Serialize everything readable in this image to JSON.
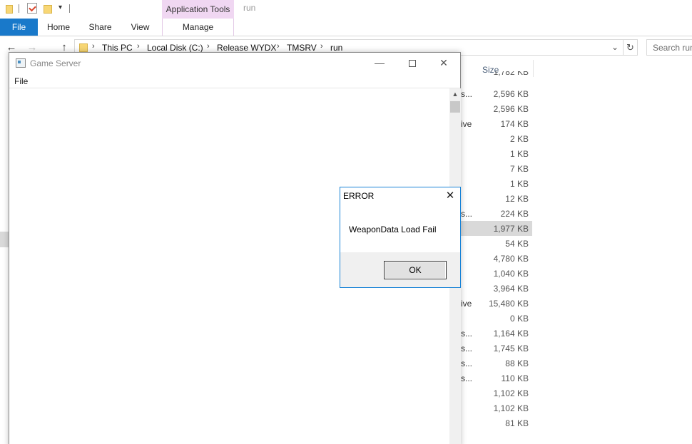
{
  "explorer": {
    "window_title": "run",
    "contextual_tab_group": "Application Tools",
    "ribbon_tabs": [
      "File",
      "Home",
      "Share",
      "View",
      "Manage"
    ],
    "breadcrumbs": [
      "This PC",
      "Local Disk (C:)",
      "Release WYDX",
      "TMSRV",
      "run"
    ],
    "search_placeholder": "Search run",
    "size_column_header": "Size",
    "rows": [
      {
        "type": "",
        "size": "1,782 KB"
      },
      {
        "type": "s...",
        "size": "2,596 KB"
      },
      {
        "type": "",
        "size": "2,596 KB"
      },
      {
        "type": "ive",
        "size": "174 KB"
      },
      {
        "type": "",
        "size": "2 KB"
      },
      {
        "type": "",
        "size": "1 KB"
      },
      {
        "type": "",
        "size": "7 KB"
      },
      {
        "type": "",
        "size": "1 KB"
      },
      {
        "type": "",
        "size": "12 KB"
      },
      {
        "type": "s...",
        "size": "224 KB"
      },
      {
        "type": "",
        "size": "1,977 KB",
        "selected": true
      },
      {
        "type": "",
        "size": "54 KB"
      },
      {
        "type": "",
        "size": "4,780 KB"
      },
      {
        "type": "",
        "size": "1,040 KB"
      },
      {
        "type": "",
        "size": "3,964 KB"
      },
      {
        "type": "ive",
        "size": "15,480 KB"
      },
      {
        "type": "",
        "size": "0 KB"
      },
      {
        "type": "s...",
        "size": "1,164 KB"
      },
      {
        "type": "s...",
        "size": "1,745 KB"
      },
      {
        "type": "s...",
        "size": "88 KB"
      },
      {
        "type": "s...",
        "size": "110 KB"
      },
      {
        "type": "",
        "size": "1,102 KB"
      },
      {
        "type": "",
        "size": "1,102 KB"
      },
      {
        "type": "",
        "size": "81 KB"
      }
    ]
  },
  "game_server": {
    "title": "Game Server",
    "menu": [
      "File"
    ]
  },
  "error_dialog": {
    "title": "ERROR",
    "message": "WeaponData Load Fail",
    "ok_label": "OK"
  },
  "colors": {
    "file_tab": "#1979ca",
    "contextual_tab": "#f0d7f2",
    "dialog_border": "#1883d7",
    "selected_row": "#d9d9d9"
  }
}
